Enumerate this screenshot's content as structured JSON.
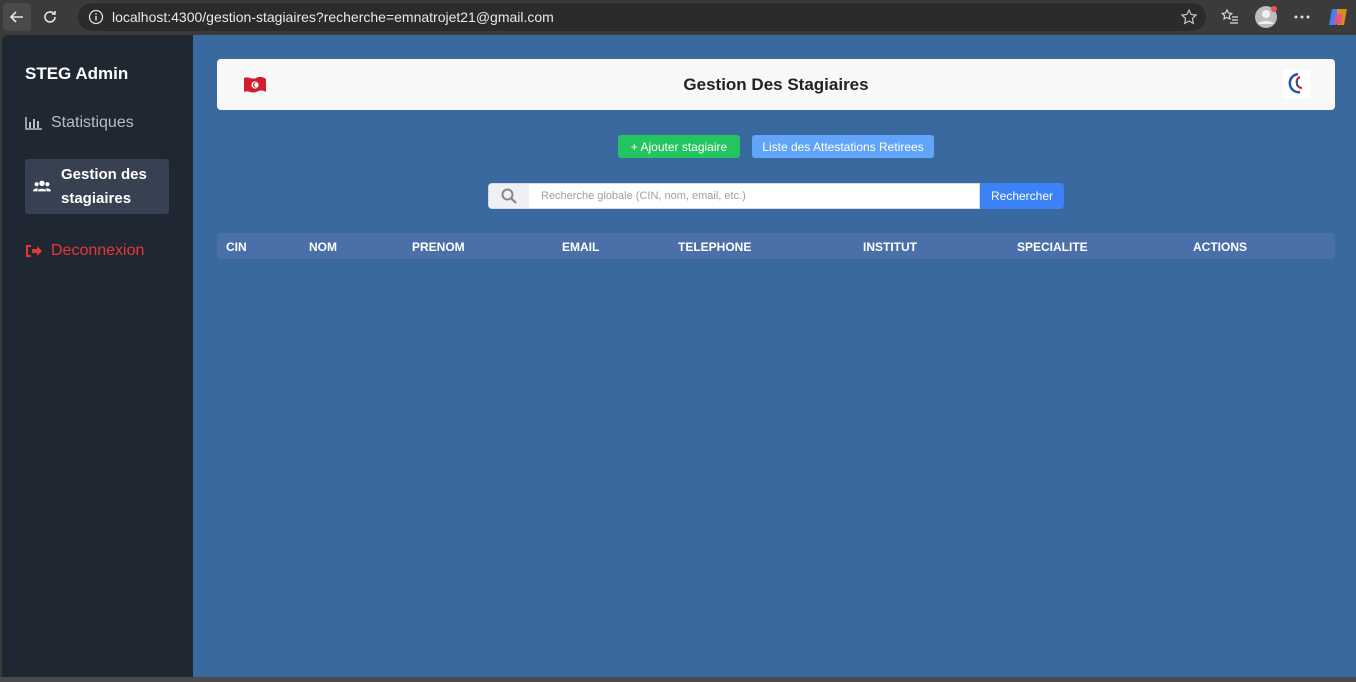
{
  "browser": {
    "url": "localhost:4300/gestion-stagiaires?recherche=emnatrojet21@gmail.com"
  },
  "sidebar": {
    "brand": "STEG Admin",
    "items": [
      {
        "label": "Statistiques",
        "icon": "bar-chart-icon"
      },
      {
        "label": "Gestion des stagiaires",
        "icon": "users-icon"
      },
      {
        "label": "Deconnexion",
        "icon": "sign-out-icon"
      }
    ]
  },
  "header": {
    "title": "Gestion Des Stagiaires"
  },
  "actions": {
    "add_label": "+ Ajouter stagiaire",
    "list_label": "Liste des Attestations Retirees"
  },
  "search": {
    "placeholder": "Recherche globale (CIN, nom, email, etc.)",
    "value": "",
    "button_label": "Rechercher"
  },
  "table": {
    "columns": [
      "CIN",
      "NOM",
      "PRENOM",
      "EMAIL",
      "TELEPHONE",
      "INSTITUT",
      "SPECIALITE",
      "ACTIONS"
    ],
    "rows": []
  },
  "colors": {
    "sidebar_bg": "#1f2733",
    "main_bg": "#3a69a0",
    "add_button": "#22c55e",
    "list_button": "#60a5fa",
    "search_button": "#3b82f6",
    "logout": "#e53935"
  }
}
